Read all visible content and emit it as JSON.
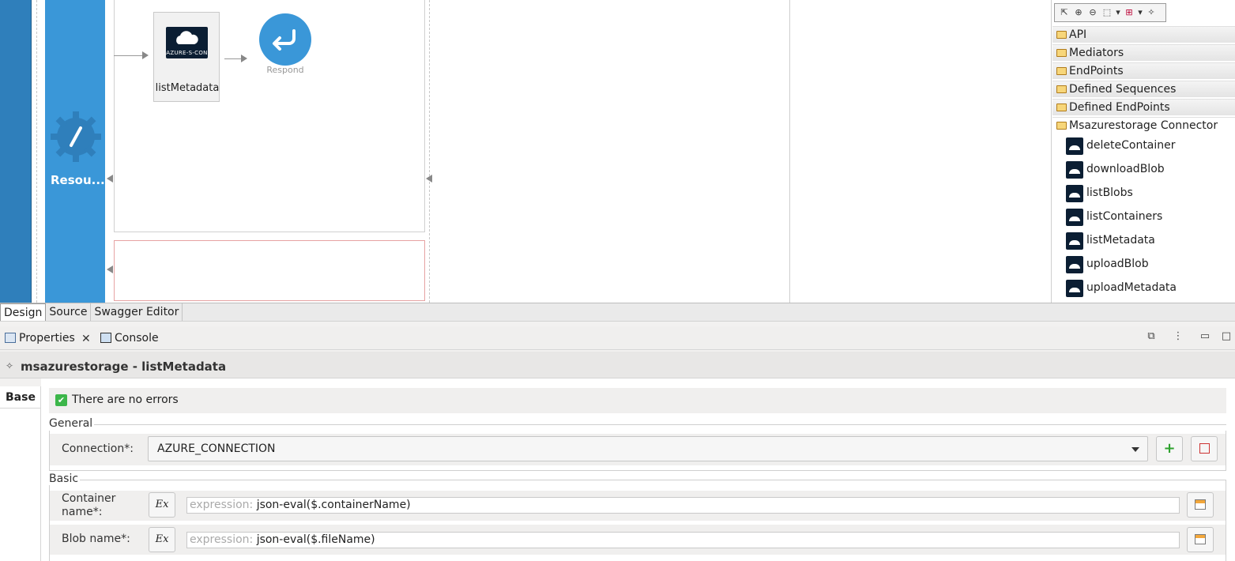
{
  "canvas": {
    "resource_label": "Resou...",
    "mediator_name": "listMetadata",
    "mediator_logo_text": "AZURE-S-CON",
    "respond_label": "Respond"
  },
  "palette": {
    "tools": [
      "select-icon",
      "zoom-in-icon",
      "zoom-out-icon",
      "marquee-icon",
      "dropdown-icon",
      "connection-icon",
      "dropdown-icon",
      "pin-icon"
    ],
    "folders": [
      "API",
      "Mediators",
      "EndPoints",
      "Defined Sequences",
      "Defined EndPoints",
      "Msazurestorage Connector"
    ],
    "items": [
      "deleteContainer",
      "downloadBlob",
      "listBlobs",
      "listContainers",
      "listMetadata",
      "uploadBlob",
      "uploadMetadata"
    ]
  },
  "editor_tabs": [
    "Design",
    "Source",
    "Swagger Editor"
  ],
  "views": {
    "properties": "Properties",
    "console": "Console"
  },
  "properties": {
    "title": "msazurestorage -  listMetadata",
    "side_tab": "Base",
    "status": "There are no errors",
    "general_label": "General",
    "connection_label": "Connection*:",
    "connection_value": "AZURE_CONNECTION",
    "basic_label": "Basic",
    "container_label_1": "Container",
    "container_label_2": "name*:",
    "container_placeholder": "expression:",
    "container_value": "json-eval($.containerName)",
    "blob_label": "Blob name*:",
    "blob_placeholder": "expression:",
    "blob_value": "json-eval($.fileName)",
    "ex_label": "Ex"
  },
  "colors": {
    "resource_blue": "#3a97d8",
    "strip_blue": "#2f7fbb",
    "fault_border": "#e6a3a3",
    "ok_green": "#3cb64a"
  }
}
